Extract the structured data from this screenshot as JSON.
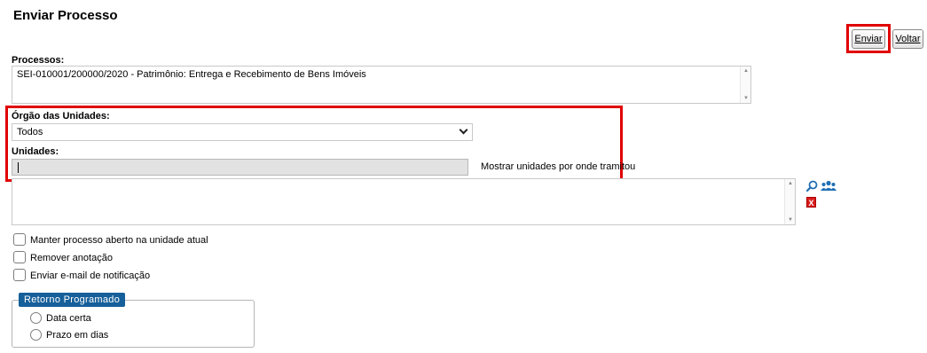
{
  "page": {
    "title": "Enviar Processo"
  },
  "toolbar": {
    "enviar_label": "Enviar",
    "voltar_label": "Voltar"
  },
  "processos": {
    "label": "Processos:",
    "value": "SEI-010001/200000/2020 - Patrimônio: Entrega e Recebimento de Bens Imóveis"
  },
  "orgao": {
    "label": "Órgão das Unidades:",
    "selected": "Todos"
  },
  "unidades": {
    "label": "Unidades:",
    "value": "",
    "link": "Mostrar unidades por onde tramitou"
  },
  "icons": {
    "search": "search-icon",
    "group": "users-group-icon",
    "remove": "remove-icon",
    "remove_glyph": "X"
  },
  "options": [
    {
      "label": "Manter processo aberto na unidade atual",
      "checked": false
    },
    {
      "label": "Remover anotação",
      "checked": false
    },
    {
      "label": "Enviar e-mail de notificação",
      "checked": false
    }
  ],
  "retorno": {
    "legend": "Retorno Programado",
    "options": [
      {
        "label": "Data certa",
        "selected": false
      },
      {
        "label": "Prazo em dias",
        "selected": false
      }
    ]
  },
  "colors": {
    "highlight": "#e00000",
    "legend_bg": "#155f9a",
    "icon_blue": "#1f6fb5",
    "remove_red": "#d81b1b"
  }
}
